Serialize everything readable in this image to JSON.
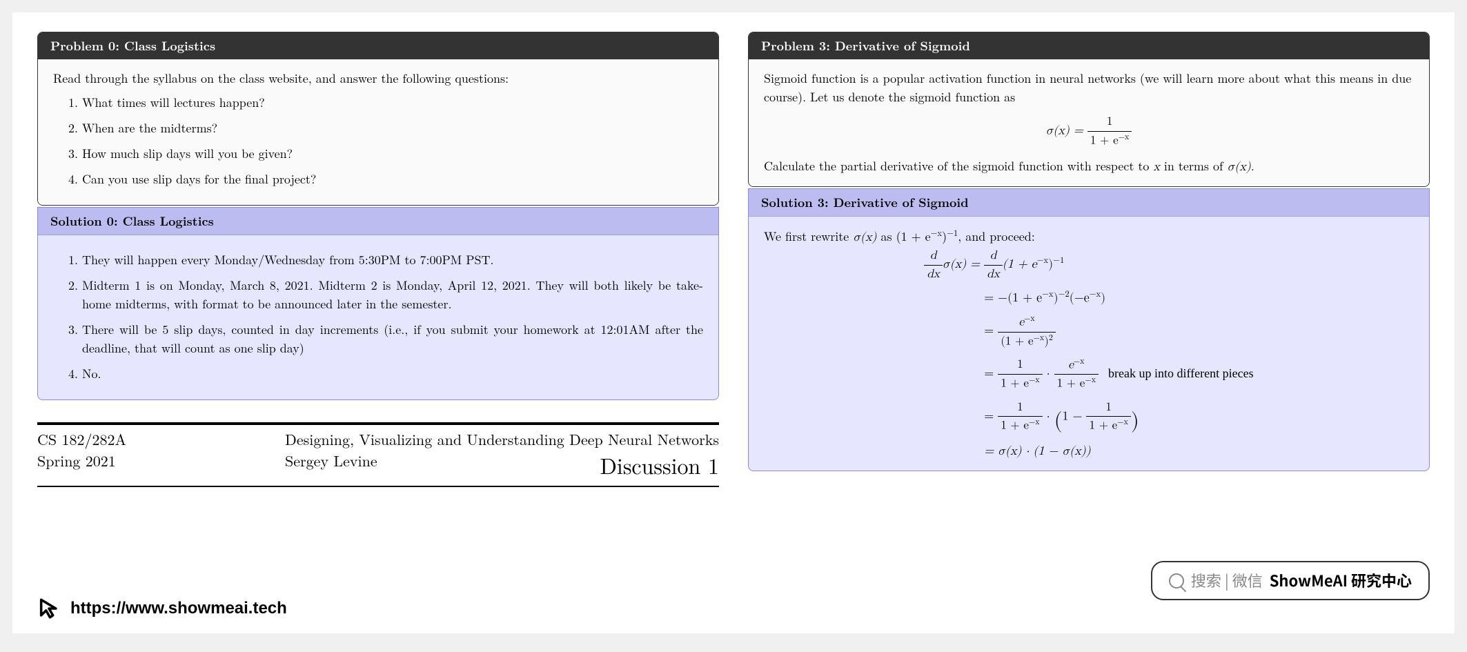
{
  "left": {
    "problem0": {
      "title": "Problem 0:  Class Logistics",
      "intro": "Read through the syllabus on the class website, and answer the following questions:",
      "q1": "What times will lectures happen?",
      "q2": "When are the midterms?",
      "q3": "How much slip days will you be given?",
      "q4": "Can you use slip days for the final project?"
    },
    "solution0": {
      "title": "Solution 0:  Class Logistics",
      "a1": "They will happen every Monday/Wednesday from 5:30PM to 7:00PM PST.",
      "a2": "Midterm 1 is on Monday, March 8, 2021. Midterm 2 is Monday, April 12, 2021. They will both likely be take-home midterms, with format to be announced later in the semester.",
      "a3": "There will be 5 slip days, counted in day increments (i.e., if you submit your homework at 12:01AM after the deadline, that will count as one slip day)",
      "a4": "No."
    },
    "titleblock": {
      "course": "CS 182/282A",
      "term": "Spring 2021",
      "coursetitle": "Designing, Visualizing and Understanding Deep Neural Networks",
      "instructor": "Sergey Levine",
      "discussion": "Discussion 1"
    }
  },
  "right": {
    "problem3": {
      "title": "Problem 3:  Derivative of Sigmoid",
      "intro": "Sigmoid function is a popular activation function in neural networks (we will learn more about what this means in due course). Let us denote the sigmoid function as",
      "sigma_lhs": "σ(x) =",
      "frac_num": "1",
      "frac_den_a": "1 + e",
      "frac_den_exp": "−x",
      "task_a": "Calculate the partial derivative of the sigmoid function with respect to ",
      "task_var": "x",
      "task_b": " in terms of ",
      "task_fn": "σ(x)",
      "task_c": "."
    },
    "solution3": {
      "title": "Solution 3:  Derivative of Sigmoid",
      "intro_a": "We first rewrite ",
      "intro_fn": "σ(x)",
      "intro_b": " as (1 + e",
      "intro_exp": "−x",
      "intro_c": ")",
      "intro_pow": "−1",
      "intro_d": ", and proceed:",
      "line1_lhs_top": "d",
      "line1_lhs_bot": "dx",
      "line1_lhs_tail": "σ(x) =",
      "line1_rhs_top": "d",
      "line1_rhs_bot": "dx",
      "line1_rhs_tail_a": "(1 + e",
      "line1_rhs_exp1": "−x",
      "line1_rhs_tail_b": ")",
      "line1_rhs_pow": "−1",
      "line2_a": "= −(1 + e",
      "line2_exp1": "−x",
      "line2_b": ")",
      "line2_pow": "−2",
      "line2_c": "(−e",
      "line2_exp2": "−x",
      "line2_d": ")",
      "line3_eq": "=",
      "line3_num_a": "e",
      "line3_num_exp": "−x",
      "line3_den_a": "(1 + e",
      "line3_den_exp": "−x",
      "line3_den_b": ")",
      "line3_den_pow": "2",
      "line4_eq": "=",
      "line4_f1_num": "1",
      "line4_f1_den_a": "1 + e",
      "line4_f1_den_exp": "−x",
      "line4_dot": " · ",
      "line4_f2_num_a": "e",
      "line4_f2_num_exp": "−x",
      "line4_f2_den_a": "1 + e",
      "line4_f2_den_exp": "−x",
      "line4_note": "break up into different pieces",
      "line5_eq": "=",
      "line5_f1_num": "1",
      "line5_f1_den_a": "1 + e",
      "line5_f1_den_exp": "−x",
      "line5_dot": " · ",
      "line5_paren_a": "1 − ",
      "line5_f2_num": "1",
      "line5_f2_den_a": "1 + e",
      "line5_f2_den_exp": "−x",
      "line6": "= σ(x) · (1 − σ(x))"
    }
  },
  "watermark": {
    "search_gray": "搜索 | 微信",
    "search_bold": "ShowMeAI 研究中心",
    "url": "https://www.showmeai.tech"
  }
}
